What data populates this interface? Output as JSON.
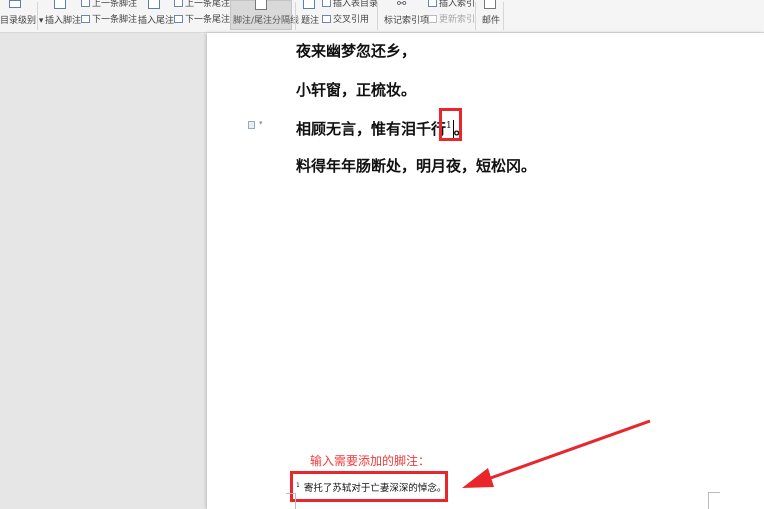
{
  "toolbar": {
    "toc_level": "目录级别",
    "insert_footnote": "插入脚注",
    "prev_footnote": "上一条脚注",
    "next_footnote": "下一条脚注",
    "insert_endnote": "插入尾注",
    "prev_endnote": "上一条尾注",
    "next_endnote": "下一条尾注",
    "separator": "脚注/尾注分隔线",
    "caption": "题注",
    "insert_table_toc": "插入表目录",
    "cross_ref": "交叉引用",
    "mark_index": "标记索引项",
    "insert_index": "插入索引",
    "update_index": "更新索引",
    "mail": "邮件"
  },
  "document": {
    "lines": [
      "夜来幽梦忽还乡，",
      "小轩窗，正梳妆。",
      "相顾无言，惟有泪千行",
      "料得年年肠断处，明月夜，短松冈。"
    ],
    "line3_ref": "1",
    "line3_end": "。",
    "footnote_num": "1",
    "footnote_text": "寄托了苏轼对于亡妻深深的悼念。"
  },
  "annotation": {
    "label": "输入需要添加的脚注：",
    "color": "#e8262b"
  }
}
